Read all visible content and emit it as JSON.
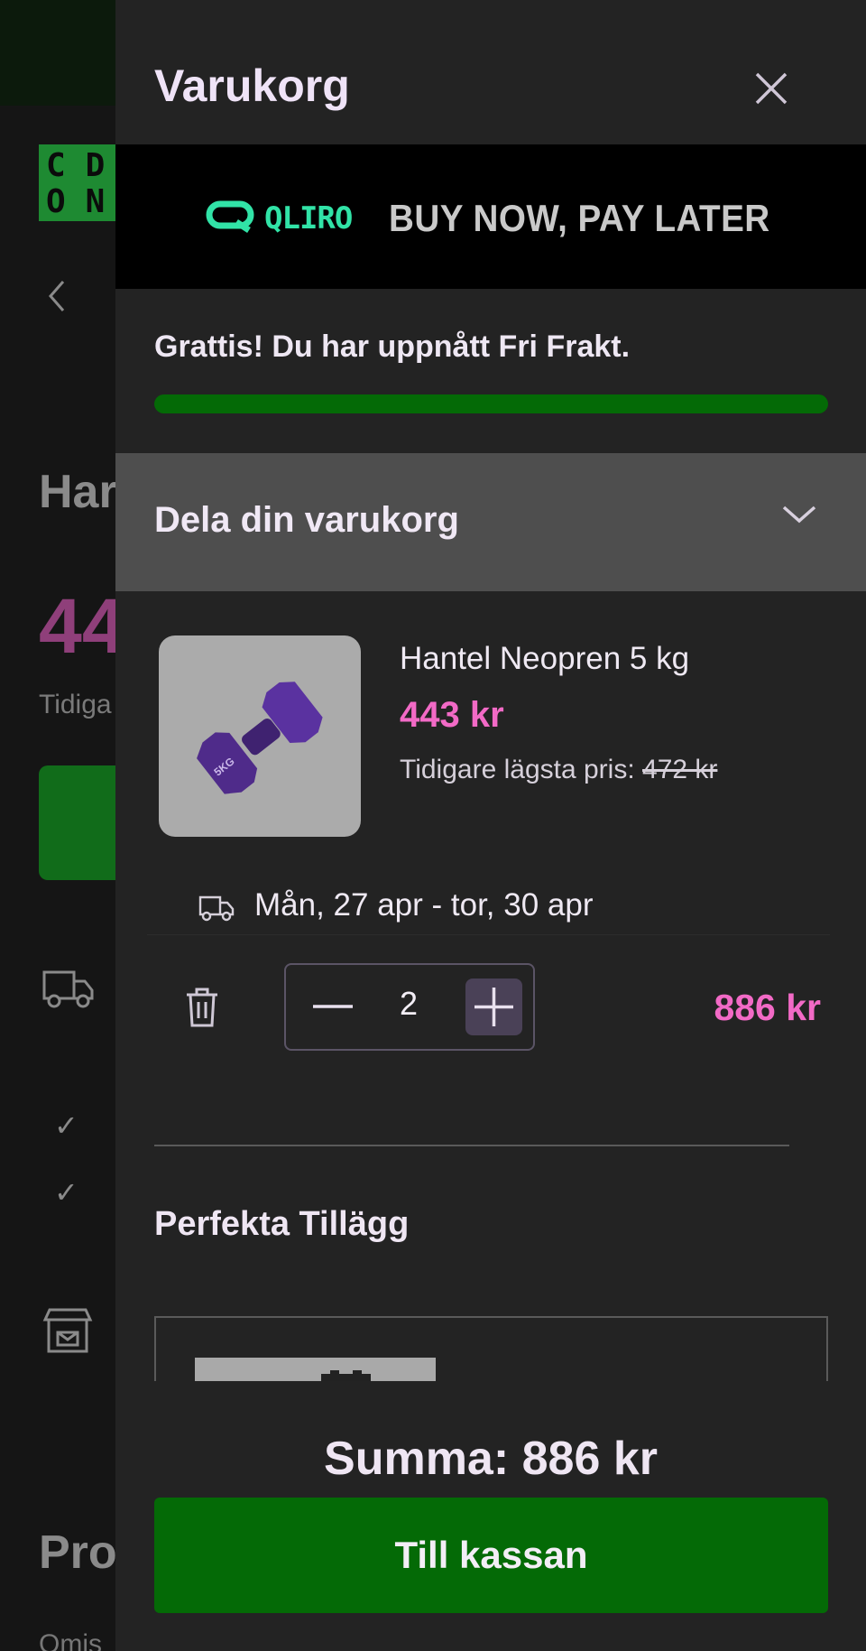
{
  "background_page": {
    "logo_text": "CD\nON",
    "title_fragment": "Har",
    "price_fragment": "44",
    "previous_fragment": "Tidiga",
    "section_fragment": "Pro",
    "footer_fragment": "Omis"
  },
  "cart": {
    "title": "Varukorg",
    "banner": {
      "brand": "QLIRO",
      "tagline": "BUY NOW, PAY LATER"
    },
    "free_shipping": {
      "message": "Grattis! Du har uppnått Fri Frakt.",
      "progress": 1.0
    },
    "share_label": "Dela din varukorg",
    "item": {
      "name": "Hantel Neopren 5 kg",
      "price": "443 kr",
      "previous_label": "Tidigare lägsta pris:",
      "previous_price": "472 kr",
      "delivery": "Mån, 27 apr - tor, 30 apr",
      "quantity": "2",
      "line_total": "886 kr",
      "thumb_text": "5KG"
    },
    "addons_title": "Perfekta Tillägg",
    "sum": "Summa: 886 kr",
    "checkout_label": "Till kassan"
  },
  "colors": {
    "accent_pink": "#f26ac6",
    "green": "#046a06",
    "qliro": "#31e3a7"
  }
}
